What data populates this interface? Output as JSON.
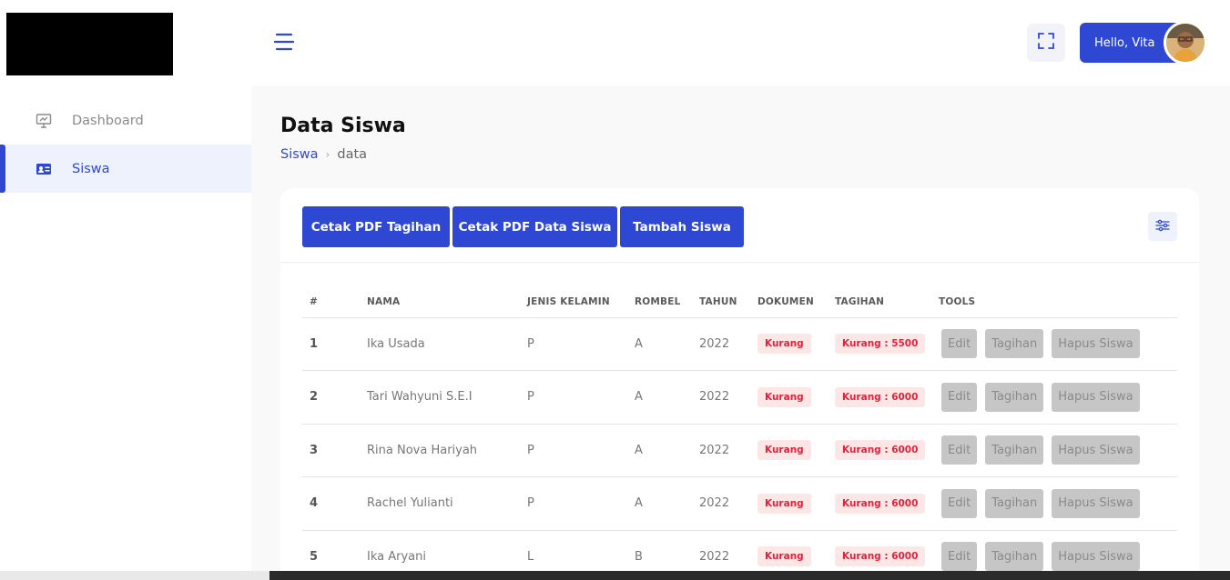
{
  "sidebar": {
    "items": [
      {
        "label": "Dashboard",
        "icon": "monitor-icon",
        "active": false
      },
      {
        "label": "Siswa",
        "icon": "id-card-icon",
        "active": true
      }
    ]
  },
  "header": {
    "greeting": "Hello, Vita"
  },
  "page": {
    "title": "Data Siswa",
    "breadcrumb": [
      "Siswa",
      "data"
    ]
  },
  "actions": [
    "Cetak PDF Tagihan",
    "Cetak PDF Data Siswa",
    "Tambah Siswa"
  ],
  "table": {
    "columns": [
      "#",
      "NAMA",
      "JENIS KELAMIN",
      "ROMBEL",
      "TAHUN",
      "DOKUMEN",
      "TAGIHAN",
      "TOOLS"
    ],
    "rows": [
      {
        "no": "1",
        "nama": "Ika Usada",
        "jk": "P",
        "rombel": "A",
        "tahun": "2022",
        "dokumen": "Kurang",
        "tagihan": "Kurang : 5500"
      },
      {
        "no": "2",
        "nama": "Tari Wahyuni S.E.I",
        "jk": "P",
        "rombel": "A",
        "tahun": "2022",
        "dokumen": "Kurang",
        "tagihan": "Kurang : 6000"
      },
      {
        "no": "3",
        "nama": "Rina Nova Hariyah",
        "jk": "P",
        "rombel": "A",
        "tahun": "2022",
        "dokumen": "Kurang",
        "tagihan": "Kurang : 6000"
      },
      {
        "no": "4",
        "nama": "Rachel Yulianti",
        "jk": "P",
        "rombel": "A",
        "tahun": "2022",
        "dokumen": "Kurang",
        "tagihan": "Kurang : 6000"
      },
      {
        "no": "5",
        "nama": "Ika Aryani",
        "jk": "L",
        "rombel": "B",
        "tahun": "2022",
        "dokumen": "Kurang",
        "tagihan": "Kurang : 6000"
      }
    ],
    "tools": [
      "Edit",
      "Tagihan",
      "Hapus Siswa"
    ]
  },
  "colors": {
    "accent": "#2f48d4",
    "badge_bg": "#fde6e6",
    "badge_text": "#e0223a",
    "tool_bg": "#c6c6c6"
  }
}
